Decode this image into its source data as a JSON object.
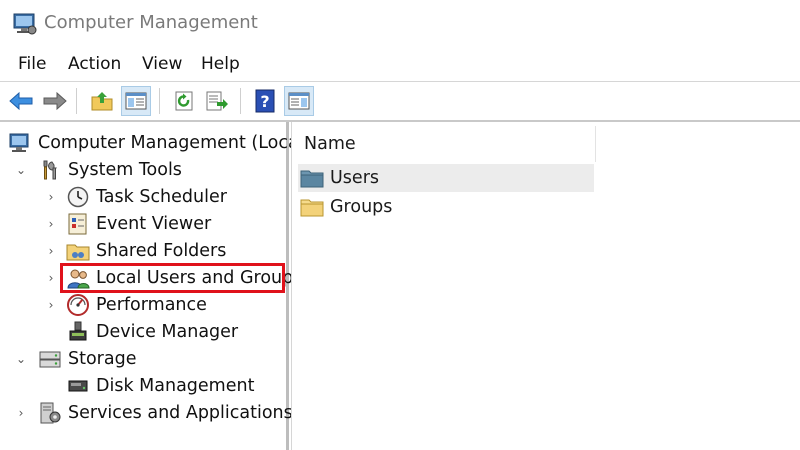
{
  "window": {
    "title": "Computer Management"
  },
  "menu": [
    "File",
    "Action",
    "View",
    "Help"
  ],
  "toolbar": {
    "buttons": [
      "back-arrow-icon",
      "forward-arrow-icon",
      "up-folder-icon",
      "show-tree-icon",
      "refresh-icon",
      "export-list-icon",
      "help-icon",
      "show-action-pane-icon"
    ]
  },
  "tree": {
    "root": "Computer Management (Local)",
    "system_tools": "System Tools",
    "task_scheduler": "Task Scheduler",
    "event_viewer": "Event Viewer",
    "shared_folders": "Shared Folders",
    "local_users_groups": "Local Users and Groups",
    "performance": "Performance",
    "device_manager": "Device Manager",
    "storage": "Storage",
    "disk_management": "Disk Management",
    "services_apps": "Services and Applications"
  },
  "content": {
    "column_name": "Name",
    "items": [
      "Users",
      "Groups"
    ]
  },
  "colors": {
    "highlight": "#e0121b",
    "accent": "#2b7bd3"
  }
}
